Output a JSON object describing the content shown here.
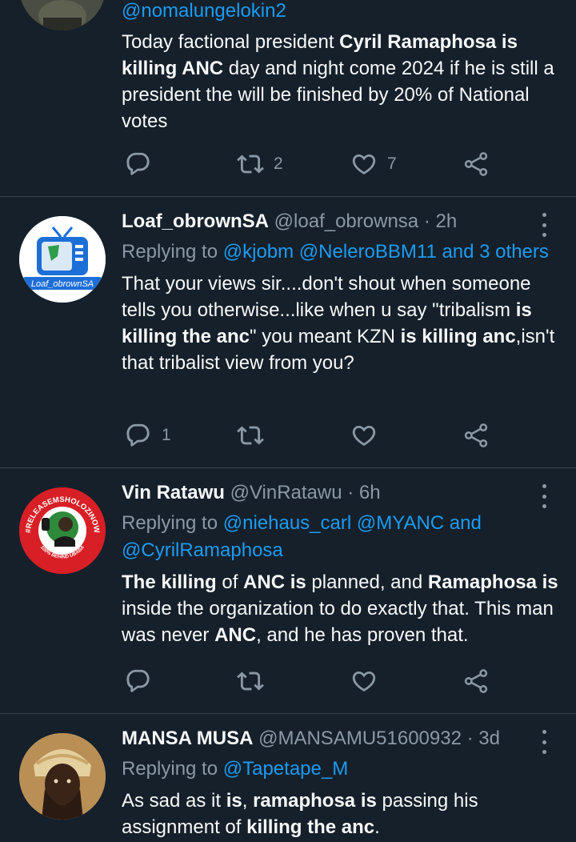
{
  "tweets": [
    {
      "handle": "@nomalungelokin2",
      "body": [
        {
          "t": "Today factional president "
        },
        {
          "t": "Cyril Ramaphosa is killing ANC",
          "b": true
        },
        {
          "t": " day and night come 2024 if he is still a president the will be finished by 20% of National votes"
        }
      ],
      "replies": "",
      "retweets": "2",
      "likes": "7"
    },
    {
      "name": "Loaf_obrownSA",
      "handle": "@loaf_obrownsa",
      "time": "· 2h",
      "replying_label": "Replying to ",
      "replying_to": "@kjobm @NeleroBBM11 and 3 others",
      "body": [
        {
          "t": "That your views sir....don't shout when someone tells you otherwise...like when u say \"tribalism "
        },
        {
          "t": "is killing the anc",
          "b": true
        },
        {
          "t": "\" you meant KZN "
        },
        {
          "t": "is killing anc",
          "b": true
        },
        {
          "t": ",isn't that tribalist view from you?"
        }
      ],
      "replies": "1",
      "retweets": "",
      "likes": "",
      "avatar_text": "Loaf_obrownSA"
    },
    {
      "name": "Vin Ratawu",
      "handle": "@VinRatawu",
      "time": "· 6h",
      "replying_label": "Replying to ",
      "replying_to": "@niehaus_carl @MYANC and @CyrilRamaphosa",
      "body": [
        {
          "t": "The killing",
          "b": true
        },
        {
          "t": " of "
        },
        {
          "t": "ANC is",
          "b": true
        },
        {
          "t": " planned, and "
        },
        {
          "t": "Ramaphosa is",
          "b": true
        },
        {
          "t": " inside the organization to do exactly that. This man was never "
        },
        {
          "t": "ANC",
          "b": true
        },
        {
          "t": ", and he has proven that."
        }
      ],
      "replies": "",
      "retweets": "",
      "likes": "",
      "avatar_text_top": "#RELEASEMSHOLOZINOW",
      "avatar_text_bottom": "100% BEHIND UBABA"
    },
    {
      "name": "MANSA MUSA",
      "handle": "@MANSAMU51600932",
      "time": "· 3d",
      "replying_label": "Replying to ",
      "replying_to": "@Tapetape_M",
      "body": [
        {
          "t": "As sad as it "
        },
        {
          "t": "is",
          "b": true
        },
        {
          "t": ", "
        },
        {
          "t": "ramaphosa is",
          "b": true
        },
        {
          "t": " passing his assignment of "
        },
        {
          "t": "killing the anc",
          "b": true
        },
        {
          "t": "."
        }
      ]
    }
  ],
  "icons": {
    "reply": "reply-icon",
    "retweet": "retweet-icon",
    "like": "heart-icon",
    "share": "share-icon",
    "more": "more-icon"
  },
  "colors": {
    "background": "#15202b",
    "link": "#1d9bf0",
    "muted": "#8b98a5",
    "divider": "#38444d"
  }
}
